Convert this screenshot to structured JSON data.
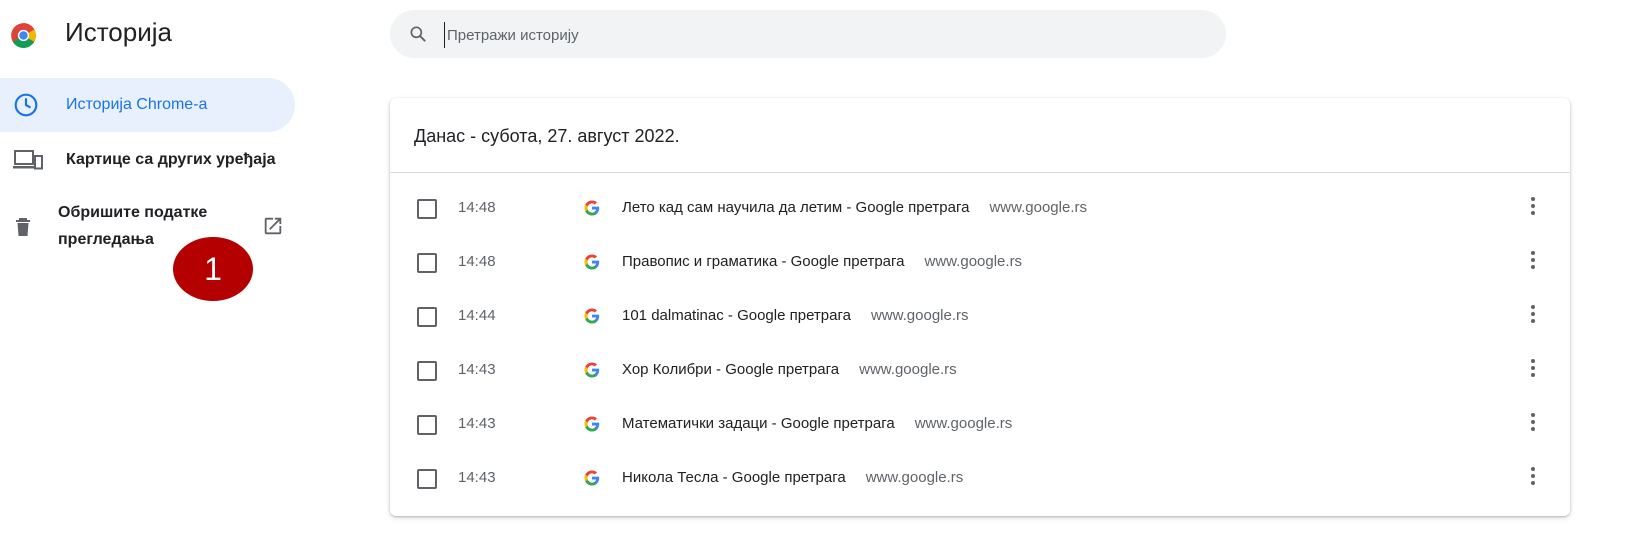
{
  "app": {
    "title": "Историја"
  },
  "sidebar": {
    "items": [
      {
        "label": "Историја Chrome-а",
        "icon": "clock-icon",
        "active": true
      },
      {
        "label": "Картице са других уређаја",
        "icon": "devices-icon"
      },
      {
        "label": "Обришите податке прегледања",
        "icon": "trash-icon",
        "trailing_icon": "open-in-new-icon"
      }
    ]
  },
  "annotation": {
    "badge": "1",
    "color": "#b40000"
  },
  "search": {
    "placeholder": "Претражи историју",
    "value": ""
  },
  "history": {
    "date_header": "Данас - субота, 27. август 2022.",
    "entries": [
      {
        "time": "14:48",
        "title": "Лето кад сам научила да летим - Google претрага",
        "domain": "www.google.rs"
      },
      {
        "time": "14:48",
        "title": "Правопис и граматика - Google претрага",
        "domain": "www.google.rs"
      },
      {
        "time": "14:44",
        "title": "101 dalmatinac - Google претрага",
        "domain": "www.google.rs"
      },
      {
        "time": "14:43",
        "title": "Хор Колибри - Google претрага",
        "domain": "www.google.rs"
      },
      {
        "time": "14:43",
        "title": "Математички задаци - Google претрага",
        "domain": "www.google.rs"
      },
      {
        "time": "14:43",
        "title": "Никола Тесла - Google претрага",
        "domain": "www.google.rs"
      }
    ]
  },
  "colors": {
    "accent": "#1a73e8",
    "active_bg": "#e8f0fe",
    "search_bg": "#f1f3f4"
  }
}
